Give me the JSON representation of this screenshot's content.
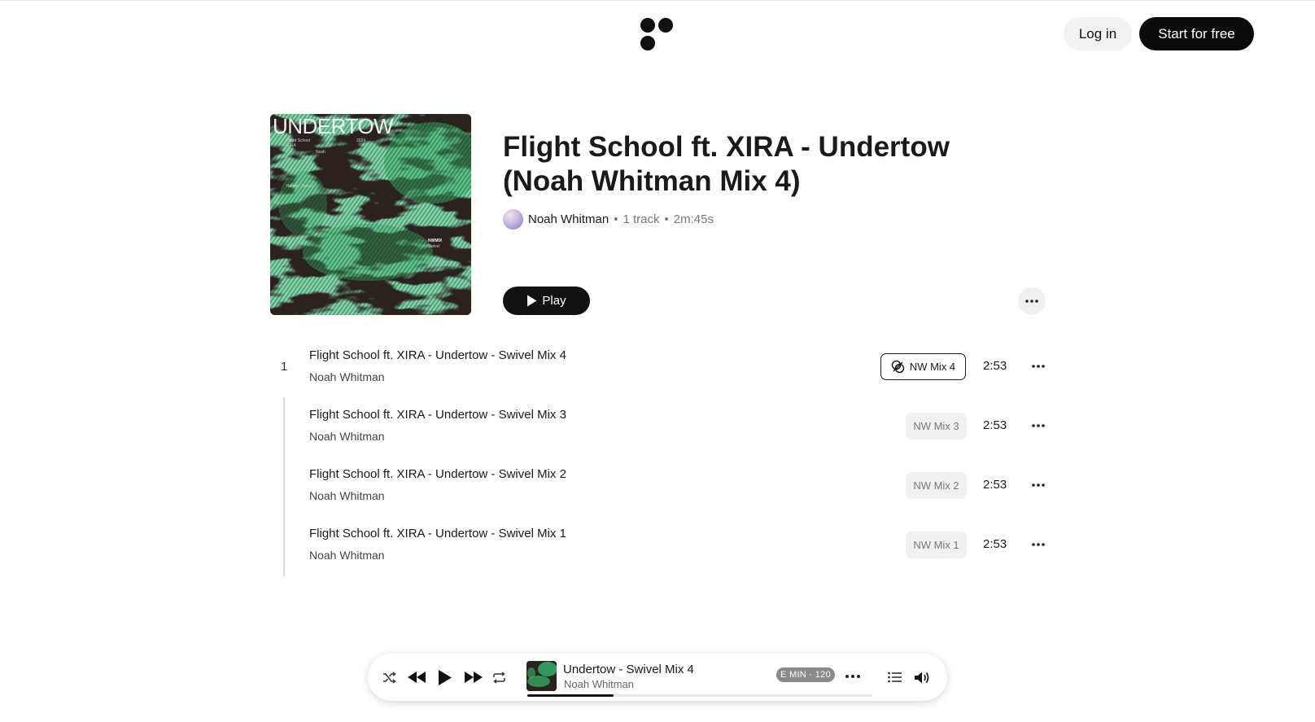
{
  "header": {
    "login_label": "Log in",
    "start_label": "Start for free"
  },
  "cover": {
    "title": "UNDERTOW",
    "small_lines": [
      "Flight School",
      "XIRA",
      "Noah",
      "2024",
      "Remix / Swivel",
      "NWMIX",
      "Swivel"
    ],
    "colors": {
      "base": "#2b2220",
      "accent": "#35b86a"
    }
  },
  "hero": {
    "title": "Flight School ft. XIRA - Undertow (Noah Whitman Mix 4)",
    "artist": "Noah Whitman",
    "sep": "•",
    "track_count": "1 track",
    "duration": "2m:45s",
    "play_label": "Play"
  },
  "tracks": {
    "number": "1",
    "items": [
      {
        "title": "Flight School ft. XIRA - Undertow - Swivel Mix 4",
        "artist": "Noah Whitman",
        "badge": "NW Mix 4",
        "duration": "2:53",
        "active": true
      },
      {
        "title": "Flight School ft. XIRA - Undertow - Swivel Mix 3",
        "artist": "Noah Whitman",
        "badge": "NW Mix 3",
        "duration": "2:53",
        "active": false
      },
      {
        "title": "Flight School ft. XIRA - Undertow - Swivel Mix 2",
        "artist": "Noah Whitman",
        "badge": "NW Mix 2",
        "duration": "2:53",
        "active": false
      },
      {
        "title": "Flight School ft. XIRA - Undertow - Swivel Mix 1",
        "artist": "Noah Whitman",
        "badge": "NW Mix 1",
        "duration": "2:53",
        "active": false
      }
    ]
  },
  "player": {
    "title": "Undertow - Swivel Mix 4",
    "artist": "Noah Whitman",
    "key_badge": "E MIN · 120",
    "progress": 0.25,
    "icons": [
      "shuffle-icon",
      "rewind-icon",
      "play-icon",
      "fast-forward-icon",
      "repeat-icon",
      "more-icon",
      "queue-icon",
      "volume-icon"
    ]
  }
}
